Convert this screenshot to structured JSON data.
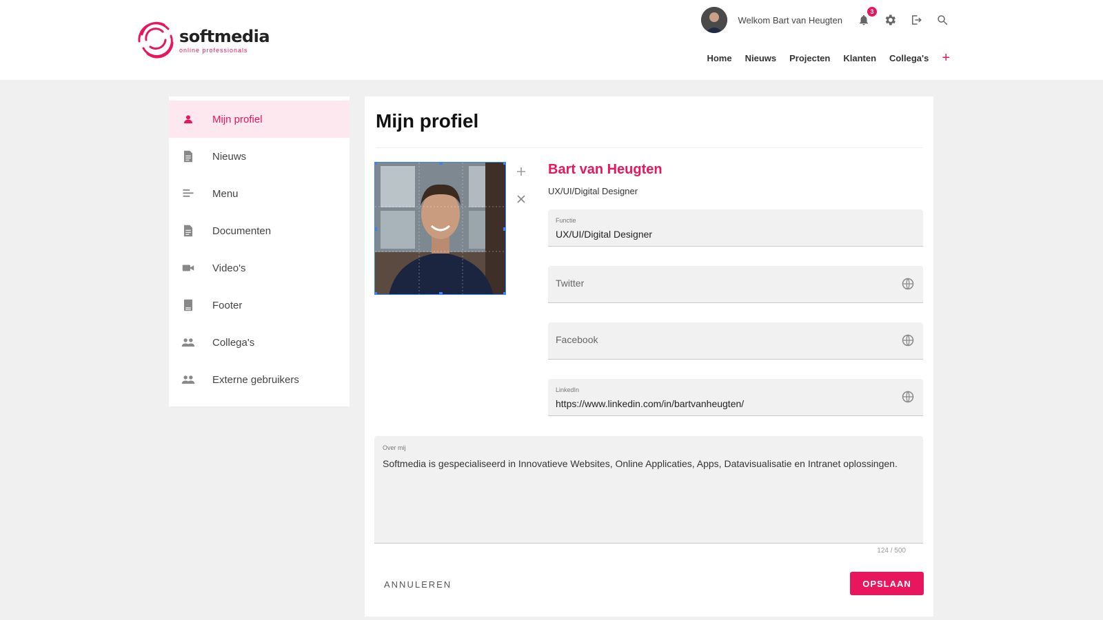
{
  "brand": {
    "name": "softmedia",
    "tagline": "online professionals",
    "accent_color": "#e8175d"
  },
  "userbar": {
    "welcome": "Welkom Bart van Heugten",
    "notification_count": "3",
    "icons": [
      "bell-icon",
      "gear-icon",
      "logout-icon",
      "search-icon"
    ]
  },
  "topnav": {
    "items": [
      "Home",
      "Nieuws",
      "Projecten",
      "Klanten",
      "Collega's"
    ],
    "add_label": "+"
  },
  "sidebar": {
    "items": [
      {
        "label": "Mijn profiel",
        "icon": "person-icon",
        "active": true
      },
      {
        "label": "Nieuws",
        "icon": "document-icon",
        "active": false
      },
      {
        "label": "Menu",
        "icon": "menu-icon",
        "active": false
      },
      {
        "label": "Documenten",
        "icon": "document-icon",
        "active": false
      },
      {
        "label": "Video's",
        "icon": "video-icon",
        "active": false
      },
      {
        "label": "Footer",
        "icon": "footer-icon",
        "active": false
      },
      {
        "label": "Collega's",
        "icon": "people-icon",
        "active": false
      },
      {
        "label": "Externe gebruikers",
        "icon": "people-icon",
        "active": false
      }
    ]
  },
  "profile": {
    "page_title": "Mijn profiel",
    "name": "Bart van Heugten",
    "role": "UX/UI/Digital Designer",
    "fields": {
      "functie": {
        "label": "Functie",
        "value": "UX/UI/Digital Designer"
      },
      "twitter": {
        "placeholder": "Twitter"
      },
      "facebook": {
        "placeholder": "Facebook"
      },
      "linkedin": {
        "label": "LinkedIn",
        "value": "https://www.linkedin.com/in/bartvanheugten/"
      }
    },
    "about": {
      "label": "Over mij",
      "value": "Softmedia is gespecialiseerd in Innovatieve Websites, Online Applicaties, Apps, Datavisualisatie en Intranet oplossingen.",
      "counter": "124 / 500"
    }
  },
  "actions": {
    "cancel": "ANNULEREN",
    "save": "OPSLAAN"
  }
}
